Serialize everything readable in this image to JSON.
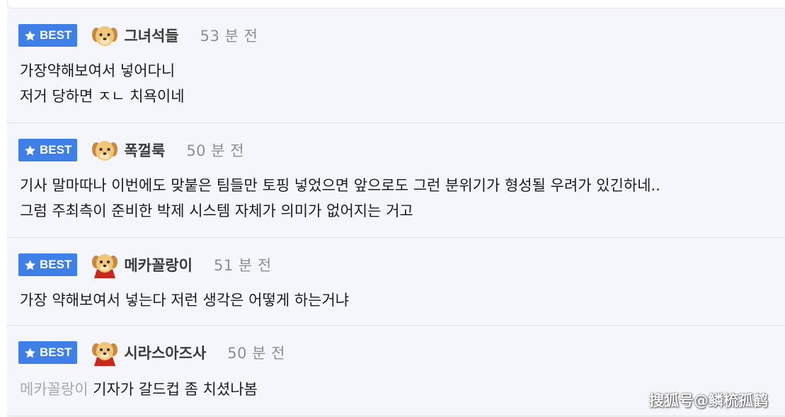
{
  "comments": [
    {
      "badge": "BEST",
      "avatar": "puppy-avatar",
      "nickname": "그녀석들",
      "time": "53 분 전",
      "lines": [
        "가장약해보여서 넣어다니",
        "저거 당하면 ㅈㄴ 치욕이네"
      ],
      "mention": ""
    },
    {
      "badge": "BEST",
      "avatar": "puppy-avatar",
      "nickname": "폭껄룩",
      "time": "50 분 전",
      "lines": [
        "기사 말마따나 이번에도 맞붙은 팀들만 토핑 넣었으면 앞으로도 그런 분위기가 형성될 우려가 있긴하네..",
        "그럼 주최측이 준비한 박제 시스템 자체가 의미가 없어지는 거고"
      ],
      "mention": ""
    },
    {
      "badge": "BEST",
      "avatar": "puppy-cape-avatar",
      "nickname": "메카꼴랑이",
      "time": "51 분 전",
      "lines": [
        "가장 약해보여서 넣는다 저런 생각은 어떻게 하는거냐"
      ],
      "mention": ""
    },
    {
      "badge": "BEST",
      "avatar": "puppy-cape-avatar",
      "nickname": "시라스아즈사",
      "time": "50 분 전",
      "lines": [
        "기자가 갈드컵 좀 치셨나봄"
      ],
      "mention": "메카꼴랑이"
    }
  ],
  "watermark": "搜狐号@鳞梳孤鹤",
  "colors": {
    "badge": "#3e7fe8",
    "background": "#f4f6fb",
    "nickname": "#3a3a3a",
    "time": "#8e8e8e",
    "mention": "#a8a8a8"
  }
}
